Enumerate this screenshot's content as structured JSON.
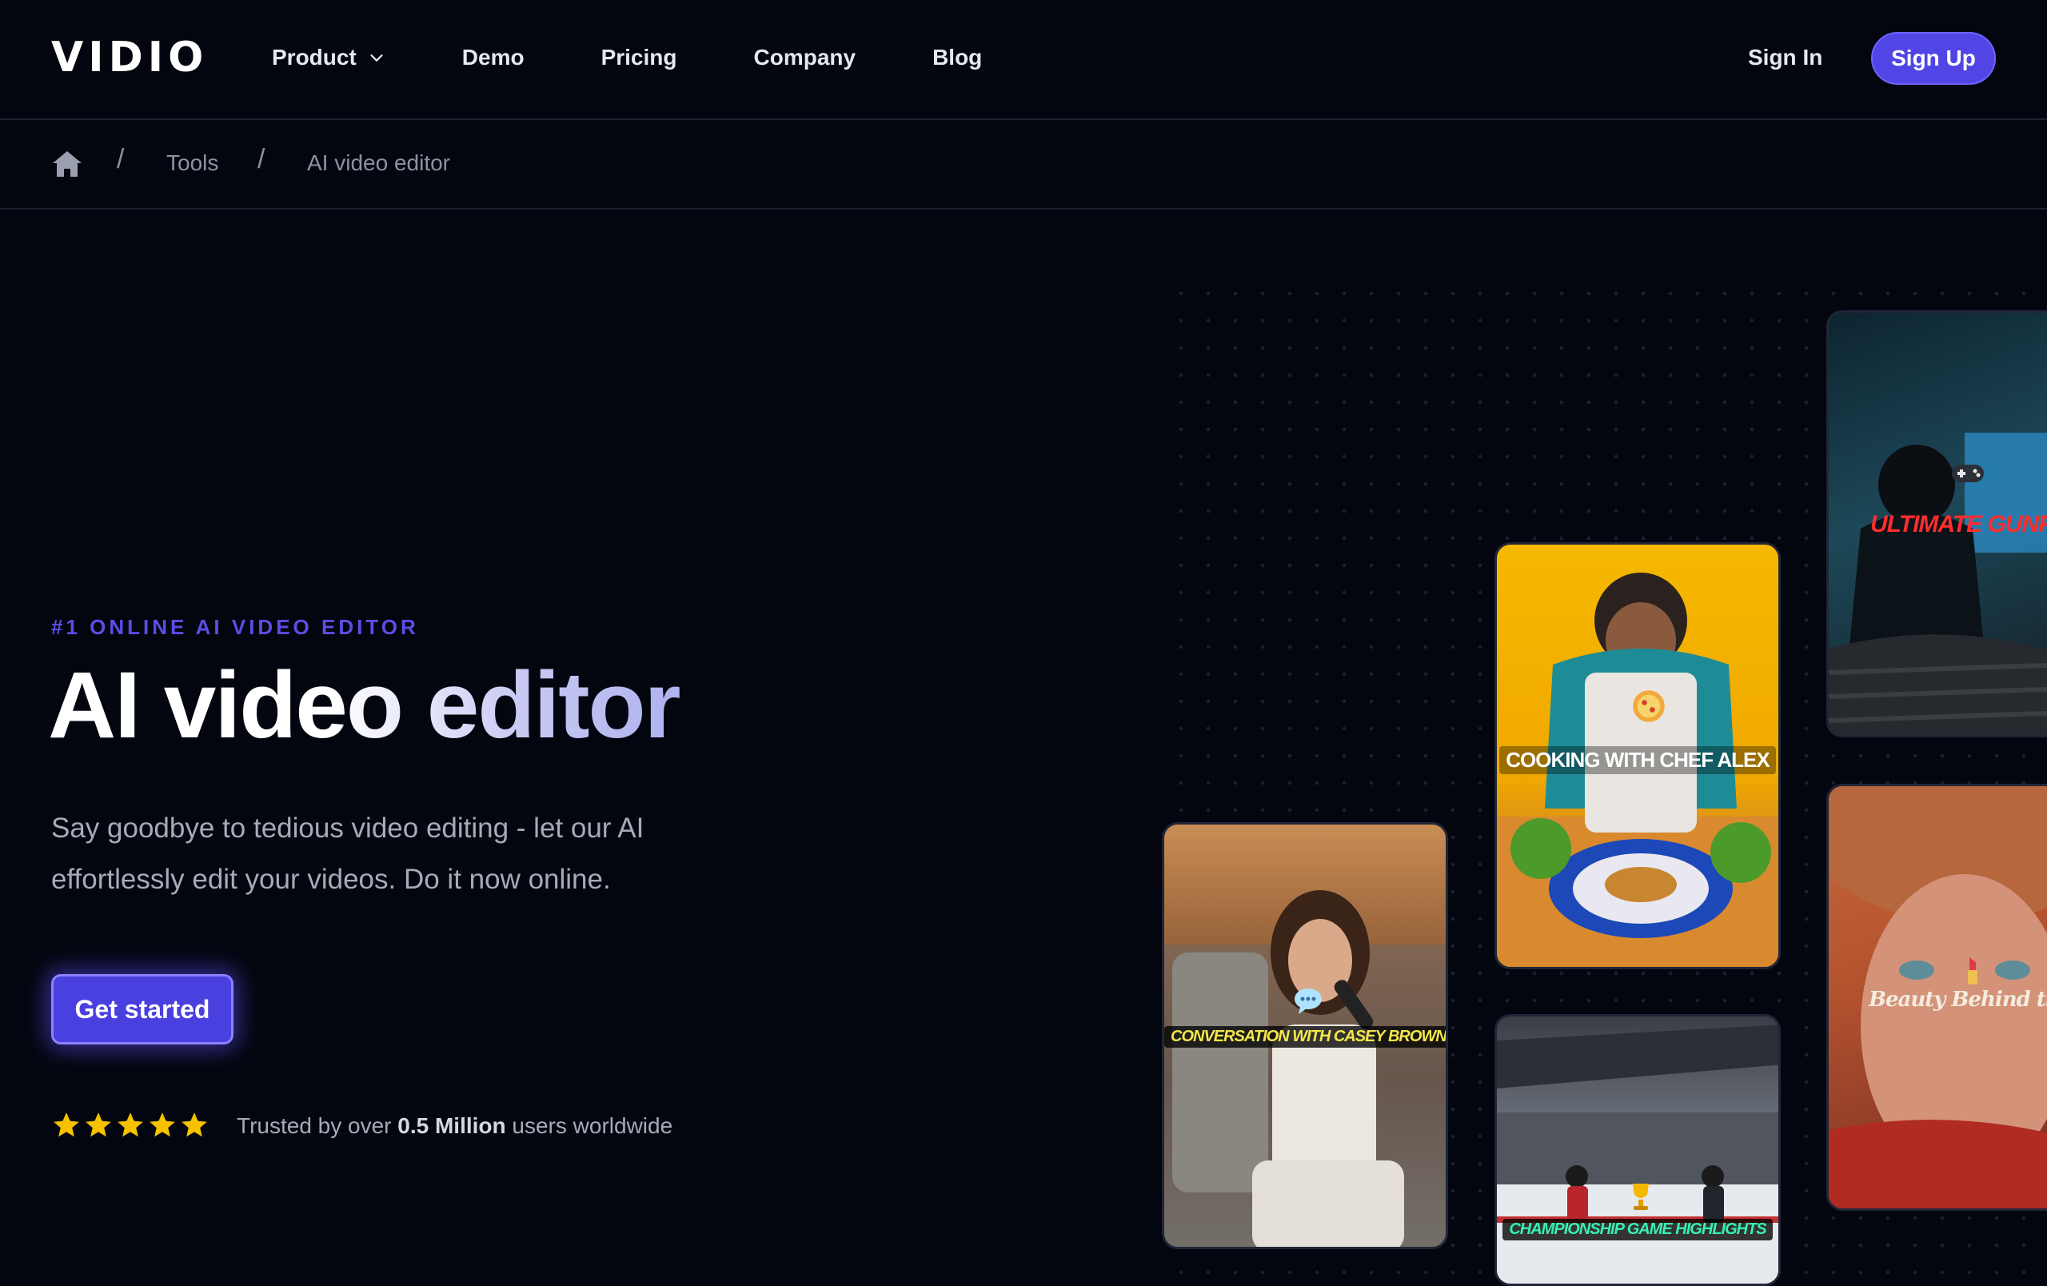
{
  "brand": {
    "logo_text": "VIDIO"
  },
  "nav": {
    "items": [
      {
        "label": "Product",
        "has_dropdown": true
      },
      {
        "label": "Demo"
      },
      {
        "label": "Pricing"
      },
      {
        "label": "Company"
      },
      {
        "label": "Blog"
      }
    ],
    "sign_in": "Sign In",
    "sign_up": "Sign Up"
  },
  "breadcrumb": {
    "home_icon": "home-icon",
    "separator": "/",
    "items": [
      "Tools",
      "AI video editor"
    ]
  },
  "hero": {
    "eyebrow": "#1 ONLINE AI VIDEO EDITOR",
    "title": "AI video editor",
    "subtitle": "Say goodbye to tedious video editing - let our AI effortlessly edit your videos. Do it now online.",
    "cta": "Get started",
    "rating_stars": 5,
    "trust_prefix": "Trusted by over",
    "trust_highlight": "0.5 Million",
    "trust_suffix": "users worldwide"
  },
  "video_cards": [
    {
      "caption": "CONVERSATION WITH CASEY BROWN",
      "emoji_icon": "speech-bubble-icon"
    },
    {
      "caption": "COOKING WITH CHEF ALEX",
      "emoji_icon": "pizza-icon"
    },
    {
      "caption": "CHAMPIONSHIP GAME HIGHLIGHTS",
      "emoji_icon": "trophy-icon"
    },
    {
      "caption": "ULTIMATE GUNFIG",
      "emoji_icon": "gamepad-icon"
    },
    {
      "caption": "Beauty Behind the Sce",
      "emoji_icon": "lipstick-icon"
    }
  ],
  "colors": {
    "background": "#04060f",
    "accent": "#5145e6",
    "eyebrow": "#5a4ee6",
    "star": "#f6c200"
  }
}
